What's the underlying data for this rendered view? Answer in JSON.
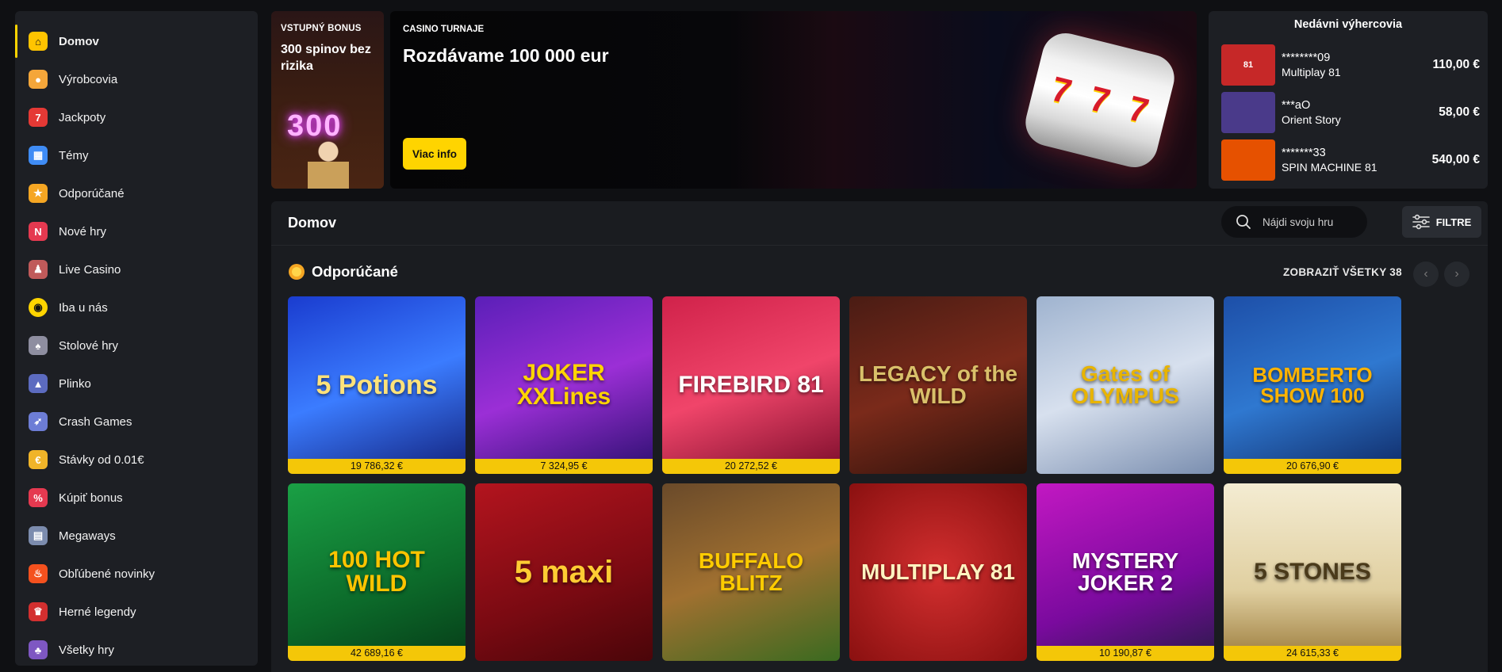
{
  "sidebar": {
    "items": [
      {
        "label": "Domov",
        "icon": "home-icon",
        "glyph": "⌂",
        "color": "#ffc400"
      },
      {
        "label": "Výrobcovia",
        "icon": "providers-icon",
        "glyph": "●",
        "color": "#f4a63a"
      },
      {
        "label": "Jackpoty",
        "icon": "jackpot-icon",
        "glyph": "7",
        "color": "#e53935"
      },
      {
        "label": "Témy",
        "icon": "themes-icon",
        "glyph": "▦",
        "color": "#3f8cf5"
      },
      {
        "label": "Odporúčané",
        "icon": "recommended-icon",
        "glyph": "★",
        "color": "#f5a623"
      },
      {
        "label": "Nové hry",
        "icon": "new-games-icon",
        "glyph": "N",
        "color": "#e53950"
      },
      {
        "label": "Live Casino",
        "icon": "live-casino-icon",
        "glyph": "♟",
        "color": "#c05a5a"
      },
      {
        "label": "Iba u nás",
        "icon": "exclusive-icon",
        "glyph": "◉",
        "color": "#ffd400"
      },
      {
        "label": "Stolové hry",
        "icon": "table-games-icon",
        "glyph": "♠",
        "color": "#8e8ea0"
      },
      {
        "label": "Plinko",
        "icon": "plinko-icon",
        "glyph": "▲",
        "color": "#5c6bc0"
      },
      {
        "label": "Crash Games",
        "icon": "rocket-icon",
        "glyph": "➶",
        "color": "#6d7dd6"
      },
      {
        "label": "Stávky od 0.01€",
        "icon": "coin-icon",
        "glyph": "€",
        "color": "#f0b429"
      },
      {
        "label": "Kúpiť bonus",
        "icon": "buy-bonus-icon",
        "glyph": "%",
        "color": "#e53950"
      },
      {
        "label": "Megaways",
        "icon": "megaways-icon",
        "glyph": "▤",
        "color": "#7c8cae"
      },
      {
        "label": "Obľúbené novinky",
        "icon": "fire-icon",
        "glyph": "♨",
        "color": "#f4511e"
      },
      {
        "label": "Herné legendy",
        "icon": "legends-icon",
        "glyph": "♛",
        "color": "#d32f2f"
      },
      {
        "label": "Všetky hry",
        "icon": "all-games-icon",
        "glyph": "♣",
        "color": "#7e57c2"
      }
    ]
  },
  "banner_bonus": {
    "tag": "VSTUPNÝ BONUS",
    "title": "300 spinov bez rizika",
    "neon": "300"
  },
  "banner_tournament": {
    "tag": "CASINO TURNAJE",
    "title": "Rozdávame 100 000 eur",
    "button": "Viac info",
    "reels": [
      "7",
      "7",
      "7"
    ]
  },
  "winners": {
    "title": "Nedávni výhercovia",
    "rows": [
      {
        "user": "********09",
        "game": "Multiplay 81",
        "amount": "110,00 €",
        "thumb": "81",
        "color": "#c62828"
      },
      {
        "user": "***aO",
        "game": "Orient Story",
        "amount": "58,00 €",
        "thumb": "",
        "color": "#4a3a8a"
      },
      {
        "user": "*******33",
        "game": "SPIN MACHINE 81",
        "amount": "540,00 €",
        "thumb": "",
        "color": "#e65100"
      }
    ]
  },
  "main": {
    "title": "Domov",
    "search_placeholder": "Nájdi svoju hru",
    "filter_label": "FILTRE"
  },
  "section": {
    "title": "Odporúčané",
    "show_all": "ZOBRAZIŤ VŠETKY 38",
    "prev": "‹",
    "next": "›"
  },
  "games": [
    {
      "name": "5 Potions",
      "jackpot": "19 786,32  €",
      "bg": "linear-gradient(160deg,#1a3ccf,#3b7cff 50%,#12207a)",
      "fg": "#ffe27a",
      "size": 34
    },
    {
      "name": "JOKER XXLines",
      "jackpot": "7 324,95  €",
      "bg": "linear-gradient(160deg,#5b1fb8,#9b2fd6 50%,#2a0f6e)",
      "fg": "#ffd400",
      "size": 30
    },
    {
      "name": "FIREBIRD 81",
      "jackpot": "20 272,52  €",
      "bg": "linear-gradient(160deg,#d0224a,#f0456a 50%,#7a0c2a)",
      "fg": "#ffffff",
      "size": 30
    },
    {
      "name": "LEGACY of the WILD",
      "jackpot": "",
      "bg": "linear-gradient(160deg,#4a1c14,#7a2a1a 50%,#2a100a)",
      "fg": "#d9c06a",
      "size": 28
    },
    {
      "name": "Gates of OLYMPUS",
      "jackpot": "",
      "bg": "linear-gradient(160deg,#9fb3cf,#d7e0ee 50%,#7b8fb0)",
      "fg": "#e8b400",
      "size": 28
    },
    {
      "name": "BOMBERTO SHOW 100",
      "jackpot": "20 676,90  €",
      "bg": "linear-gradient(160deg,#1d4fa8,#2f78d0 50%,#0f2a66)",
      "fg": "#ffb300",
      "size": 26
    },
    {
      "name": "100 HOT WILD",
      "jackpot": "42 689,16  €",
      "bg": "linear-gradient(160deg,#1aa045,#0c6a2a 60%,#063d18)",
      "fg": "#ffc400",
      "size": 30
    },
    {
      "name": "5 maxi",
      "jackpot": "",
      "bg": "linear-gradient(160deg,#b3141e,#7a0a12 60%,#4a0509)",
      "fg": "#ffcc33",
      "size": 40
    },
    {
      "name": "BUFFALO BLITZ",
      "jackpot": "",
      "bg": "linear-gradient(160deg,#6a4a2a,#a07030 50%,#3a6a20)",
      "fg": "#ffcc00",
      "size": 28
    },
    {
      "name": "MULTIPLAY 81",
      "jackpot": "",
      "bg": "radial-gradient(circle,#d32f2f,#8a1010)",
      "fg": "#fff3c0",
      "size": 28
    },
    {
      "name": "MYSTERY JOKER 2",
      "jackpot": "10 190,87  €",
      "bg": "linear-gradient(160deg,#c218c2,#7a0a9e 60%,#2a1a4a)",
      "fg": "#ffffff",
      "size": 28
    },
    {
      "name": "5 STONES",
      "jackpot": "24 615,33  €",
      "bg": "linear-gradient(180deg,#f4ecd2,#e0cfa0 60%,#9a7a3a)",
      "fg": "#4a3a1a",
      "size": 30
    }
  ]
}
